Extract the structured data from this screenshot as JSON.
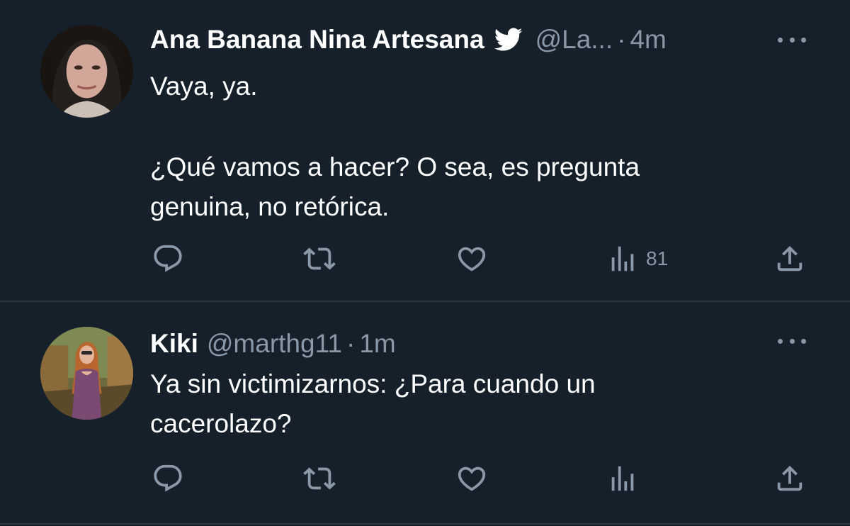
{
  "tweets": [
    {
      "name": "Ana Banana Nina Artesana",
      "verified": true,
      "handle": "@La...",
      "separator": "·",
      "time": "4m",
      "body": [
        "Vaya, ya.",
        "¿Qué vamos a hacer? O sea, es pregunta genuina, no retórica."
      ],
      "views": "81",
      "icons": {
        "reply": "reply-icon",
        "retweet": "retweet-icon",
        "like": "heart-icon",
        "views": "views-icon",
        "share": "share-icon",
        "more": "more-icon"
      }
    },
    {
      "name": "Kiki",
      "verified": false,
      "handle": "@marthg11",
      "separator": "·",
      "time": "1m",
      "body": [
        "Ya sin victimizarnos: ¿Para cuando un cacerolazo?"
      ],
      "views": "",
      "icons": {
        "reply": "reply-icon",
        "retweet": "retweet-icon",
        "like": "heart-icon",
        "views": "views-icon",
        "share": "share-icon",
        "more": "more-icon"
      }
    }
  ],
  "colors": {
    "background": "#15202b",
    "text": "#ffffff",
    "secondary": "#8b98a5",
    "divider": "#2a3640"
  }
}
